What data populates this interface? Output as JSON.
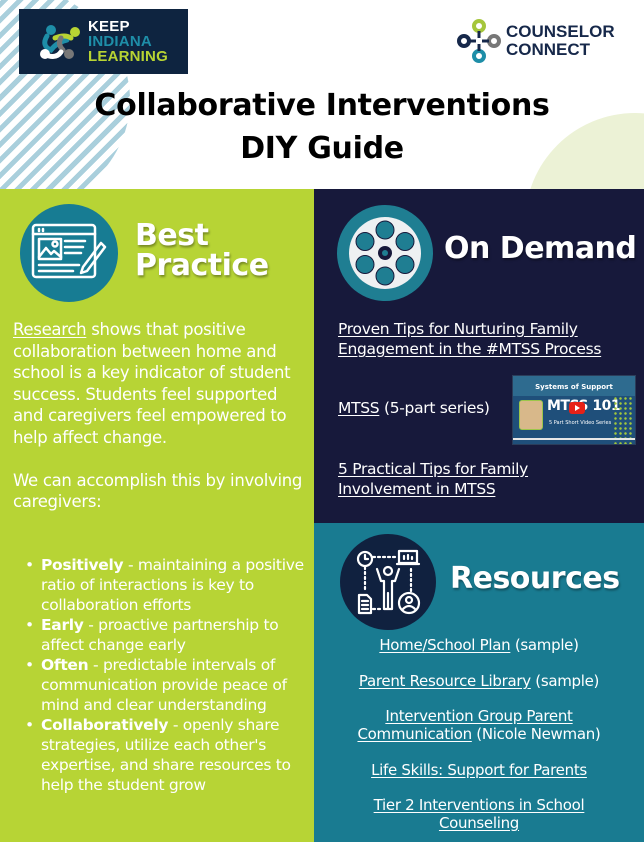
{
  "header": {
    "logo_left": {
      "line1": "KEEP",
      "line2": "INDIANA",
      "line3": "LEARNING"
    },
    "logo_right": {
      "line1": "COUNSELOR",
      "line2": "CONNECT"
    },
    "title_line1": "Collaborative Interventions",
    "title_line2": "DIY Guide"
  },
  "best_practice": {
    "heading_line1": "Best",
    "heading_line2": "Practice",
    "icon": "article-edit-icon",
    "intro_link": "Research",
    "intro_text": " shows that positive collaboration between home and school is a key indicator of student success. Students feel supported and caregivers feel empowered to help affect change.",
    "lead": "We can accomplish this by involving caregivers:",
    "items": [
      {
        "term": "Positively",
        "desc": " - maintaining a positive ratio of interactions is key to collaboration efforts"
      },
      {
        "term": "Early",
        "desc": " - proactive partnership to affect change early"
      },
      {
        "term": "Often",
        "desc": " - predictable intervals of communication provide peace of mind and clear understanding"
      },
      {
        "term": "Collaboratively",
        "desc": " - openly share strategies, utilize each other's expertise, and share resources to help the student grow"
      }
    ]
  },
  "on_demand": {
    "heading": "On Demand",
    "icon": "film-reel-icon",
    "links": [
      {
        "label": "Proven Tips for Nurturing Family Engagement in the #MTSS Process",
        "suffix": ""
      },
      {
        "label": "MTSS",
        "suffix": " (5-part series)"
      },
      {
        "label": "5 Practical Tips for Family Involvement in MTSS",
        "suffix": ""
      }
    ],
    "video_thumbnail": {
      "top_text": "Systems of Support",
      "title": "MTSS 101",
      "subtitle": "5 Part Short Video Series"
    }
  },
  "resources": {
    "heading": "Resources",
    "icon": "workflow-person-icon",
    "links": [
      {
        "label": "Home/School Plan",
        "suffix": " (sample)"
      },
      {
        "label": "Parent Resource Library",
        "suffix": " (sample)"
      },
      {
        "label": "Intervention Group Parent Communication",
        "suffix": " (Nicole Newman)"
      },
      {
        "label": "Life Skills: Support for Parents",
        "suffix": ""
      },
      {
        "label": "Tier 2 Interventions in School Counseling",
        "suffix": ""
      }
    ]
  },
  "colors": {
    "lime": "#b7d435",
    "navy": "#17193b",
    "teal": "#197b91",
    "dark_blue": "#0e2440"
  }
}
